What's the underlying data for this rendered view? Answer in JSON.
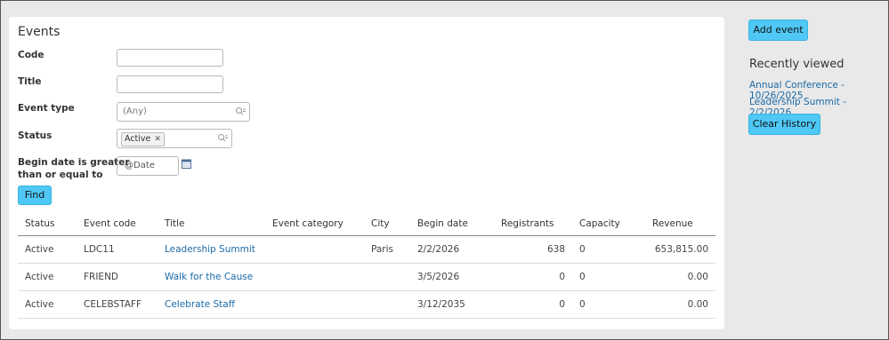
{
  "search": {
    "title": "Events",
    "fields": {
      "code_label": "Code",
      "title_label": "Title",
      "event_type_label": "Event type",
      "event_type_placeholder": "(Any)",
      "status_label": "Status",
      "status_selected": "Active",
      "begin_date_label_1": "Begin date is greater",
      "begin_date_label_2": "than or equal to",
      "begin_date_value": "@Date"
    },
    "find_label": "Find"
  },
  "results": {
    "columns": [
      "Status",
      "Event code",
      "Title",
      "Event category",
      "City",
      "Begin date",
      "Registrants",
      "Capacity",
      "Revenue"
    ],
    "rows": [
      {
        "status": "Active",
        "code": "LDC11",
        "title": "Leadership Summit",
        "category": "",
        "city": "Paris",
        "begin": "2/2/2026",
        "registrants": "638",
        "capacity": "0",
        "revenue": "653,815.00"
      },
      {
        "status": "Active",
        "code": "FRIEND",
        "title": "Walk for the Cause",
        "category": "",
        "city": "",
        "begin": "3/5/2026",
        "registrants": "0",
        "capacity": "0",
        "revenue": "0.00"
      },
      {
        "status": "Active",
        "code": "CELEBSTAFF",
        "title": "Celebrate Staff",
        "category": "",
        "city": "",
        "begin": "3/12/2035",
        "registrants": "0",
        "capacity": "0",
        "revenue": "0.00"
      }
    ]
  },
  "sidebar": {
    "add_event_label": "Add event",
    "recently_viewed_title": "Recently viewed",
    "recent": [
      "Annual Conference - 10/26/2025",
      "Leadership Summit - 2/2/2026"
    ],
    "clear_history_label": "Clear History"
  },
  "icons": {
    "lookup": "magnifier-list-icon",
    "calendar": "calendar-icon",
    "remove": "close-icon"
  },
  "colors": {
    "accent_button": "#4fc8f5",
    "link": "#1b6aa6"
  }
}
